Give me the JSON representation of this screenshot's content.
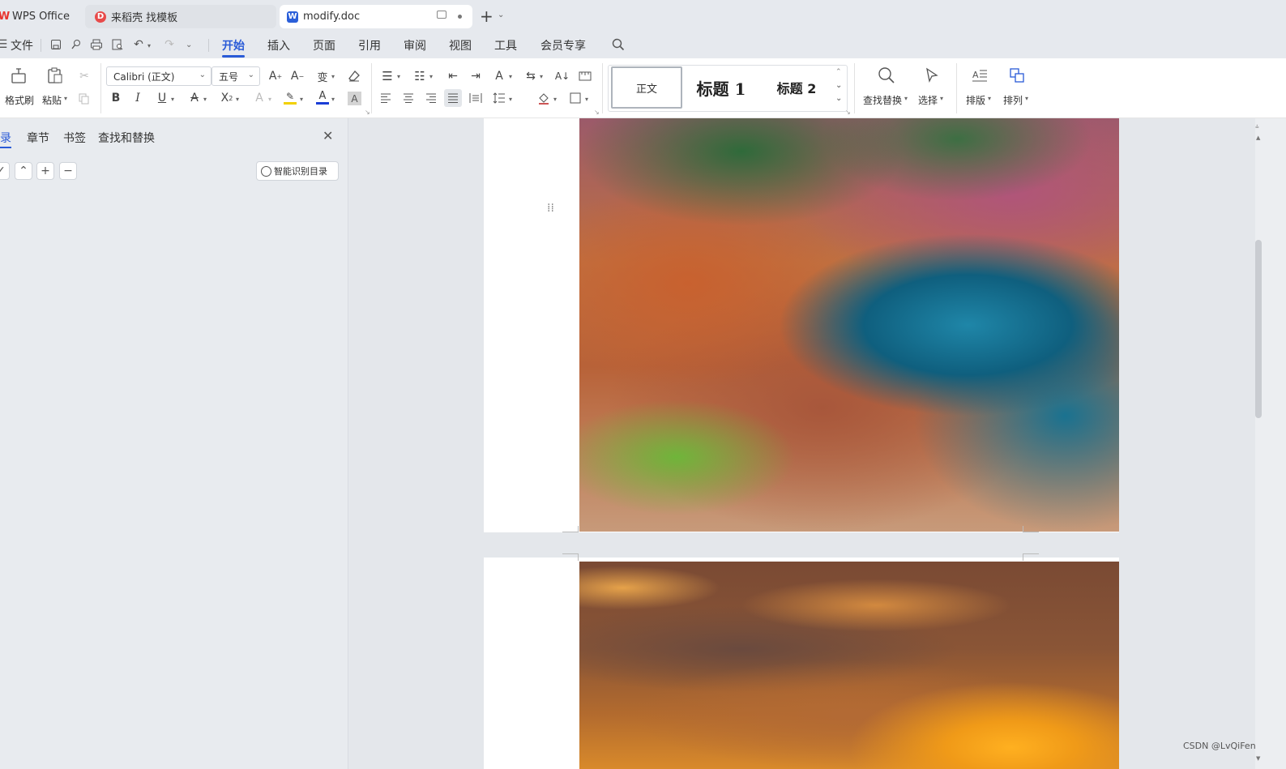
{
  "tabs": [
    {
      "label": "WPS Office",
      "icon": "wps-logo-icon"
    },
    {
      "label": "来稻壳 找模板",
      "icon": "docer-icon"
    },
    {
      "label": "modify.doc",
      "icon": "word-doc-icon",
      "active": true
    }
  ],
  "menu": {
    "file": "文件",
    "items": [
      "开始",
      "插入",
      "页面",
      "引用",
      "审阅",
      "视图",
      "工具",
      "会员专享"
    ],
    "active": "开始"
  },
  "ribbon": {
    "format_painter": "格式刷",
    "paste": "粘贴",
    "font_name": "Calibri (正文)",
    "font_size": "五号",
    "styles": [
      "正文",
      "标题 1",
      "标题 2"
    ],
    "find_replace": "查找替换",
    "select": "选择",
    "layout": "排版",
    "arrange": "排列"
  },
  "nav": {
    "tabs": [
      "目录",
      "章节",
      "书签",
      "查找和替换"
    ],
    "active": "目录",
    "smart_toc": "智能识别目录"
  },
  "watermark": "CSDN @LvQiFen",
  "colors": {
    "accent": "#2a5bd7",
    "word_blue": "#2b5fd9",
    "wps_red": "#e8342f",
    "docer_red": "#e84a4a"
  }
}
